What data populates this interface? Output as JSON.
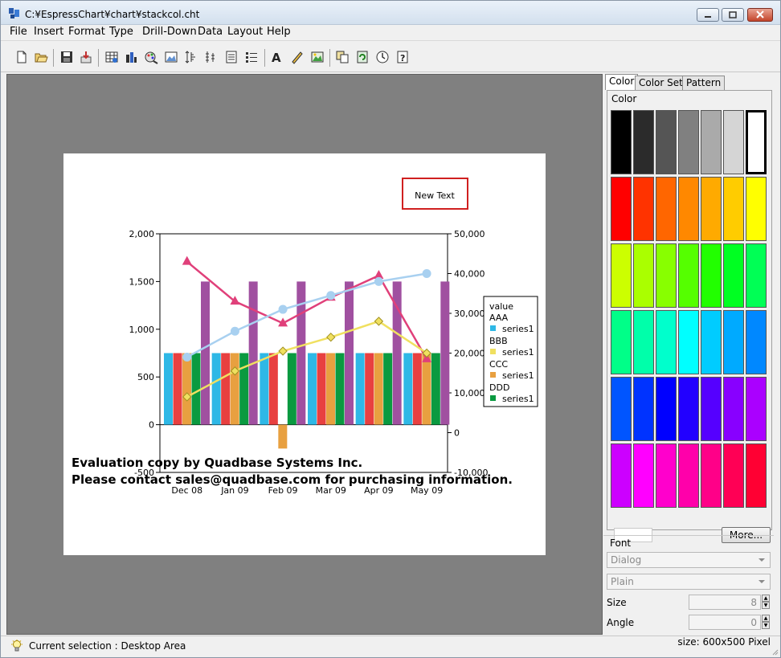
{
  "window": {
    "title": "C:¥EspressChart¥chart¥stackcol.cht"
  },
  "menu": [
    "File",
    "Insert",
    "Format",
    "Type",
    "Drill-Down",
    "Data",
    "Layout",
    "Help"
  ],
  "toolbar_icons": [
    "new-file-icon",
    "open-folder-icon",
    "save-icon",
    "export-icon",
    "chart-data-icon",
    "chart-type-icon",
    "palette-icon",
    "background-icon",
    "axis-scale-icon",
    "axis-ticks-icon",
    "data-table-icon",
    "legend-icon",
    "text-icon",
    "pen-icon",
    "image-icon",
    "copy-icon",
    "refresh-icon",
    "timer-icon",
    "help-icon"
  ],
  "chart": {
    "text_box": "New Text",
    "watermark_line1": "Evaluation copy by Quadbase Systems Inc.",
    "watermark_line2": "Please contact sales@quadbase.com for purchasing information.",
    "left_ticks": [
      "2,000",
      "1,500",
      "1,000",
      "500",
      "0",
      "-500"
    ],
    "right_ticks": [
      "50,000",
      "40,000",
      "30,000",
      "20,000",
      "10,000",
      "0",
      "-10,000"
    ],
    "legend_title": "value",
    "legend": [
      {
        "group": "AAA",
        "label": "series1",
        "color": "#2eb8e6"
      },
      {
        "group": "BBB",
        "label": "series1",
        "color": "#f0e060"
      },
      {
        "group": "CCC",
        "label": "series1",
        "color": "#e8a040"
      },
      {
        "group": "DDD",
        "label": "series1",
        "color": "#0a9a40"
      }
    ]
  },
  "chart_data": {
    "type": "bar",
    "categories": [
      "Dec 08",
      "Jan 09",
      "Feb 09",
      "Mar 09",
      "Apr 09",
      "May 09"
    ],
    "ylim": [
      -500,
      2000
    ],
    "y2lim": [
      -10000,
      50000
    ],
    "series": [
      {
        "name": "AAA",
        "type": "bar",
        "color": "#2eb8e6",
        "values": [
          750,
          750,
          750,
          750,
          750,
          750
        ]
      },
      {
        "type": "bar",
        "color": "#e84040",
        "values": [
          750,
          750,
          750,
          750,
          750,
          750
        ]
      },
      {
        "name": "CCC",
        "type": "bar",
        "color": "#e8a040",
        "values": [
          750,
          750,
          -250,
          750,
          750,
          750
        ]
      },
      {
        "name": "DDD",
        "type": "bar",
        "color": "#0a9a40",
        "values": [
          750,
          750,
          750,
          750,
          750,
          750
        ]
      },
      {
        "type": "bar",
        "color": "#a050a0",
        "values": [
          1500,
          1500,
          1500,
          1500,
          1500,
          1500
        ]
      },
      {
        "type": "line",
        "axis": "right",
        "color": "#e0407a",
        "marker": "triangle",
        "values": [
          43000,
          33000,
          27500,
          34000,
          39500,
          18500
        ]
      },
      {
        "type": "line",
        "axis": "right",
        "color": "#a8d0f0",
        "marker": "circle",
        "values": [
          19000,
          25500,
          31000,
          34500,
          38000,
          40000
        ]
      },
      {
        "name": "BBB",
        "type": "line",
        "axis": "right",
        "color": "#f0e060",
        "marker": "diamond",
        "values": [
          9000,
          15500,
          20500,
          24000,
          28000,
          20000
        ]
      }
    ]
  },
  "palette": {
    "tabs": [
      "Color",
      "Color Set",
      "Pattern"
    ],
    "group_label": "Color",
    "colors": [
      [
        "#000000",
        "#2b2b2b",
        "#555555",
        "#808080",
        "#aaaaaa",
        "#d5d5d5",
        "#ffffff"
      ],
      [
        "#ff0000",
        "#ff3300",
        "#ff6600",
        "#ff8800",
        "#ffaa00",
        "#ffcc00",
        "#ffff00"
      ],
      [
        "#ccff00",
        "#aaff00",
        "#88ff00",
        "#55ff00",
        "#22ff00",
        "#00ff22",
        "#00ff55"
      ],
      [
        "#00ff88",
        "#00ffaa",
        "#00ffcc",
        "#00ffff",
        "#00ccff",
        "#00aaff",
        "#0088ff"
      ],
      [
        "#0055ff",
        "#0033ff",
        "#0000ff",
        "#2200ff",
        "#5500ff",
        "#8800ff",
        "#aa00ff"
      ],
      [
        "#cc00ff",
        "#ff00ff",
        "#ff00cc",
        "#ff00aa",
        "#ff0088",
        "#ff0055",
        "#ff0033"
      ]
    ],
    "more_label": "More..."
  },
  "font_panel": {
    "label": "Font",
    "family": "Dialog",
    "style": "Plain",
    "size_label": "Size",
    "size_value": "8",
    "angle_label": "Angle",
    "angle_value": "0"
  },
  "status": {
    "text": "Current selection : Desktop Area",
    "size": "size: 600x500 Pixel"
  }
}
